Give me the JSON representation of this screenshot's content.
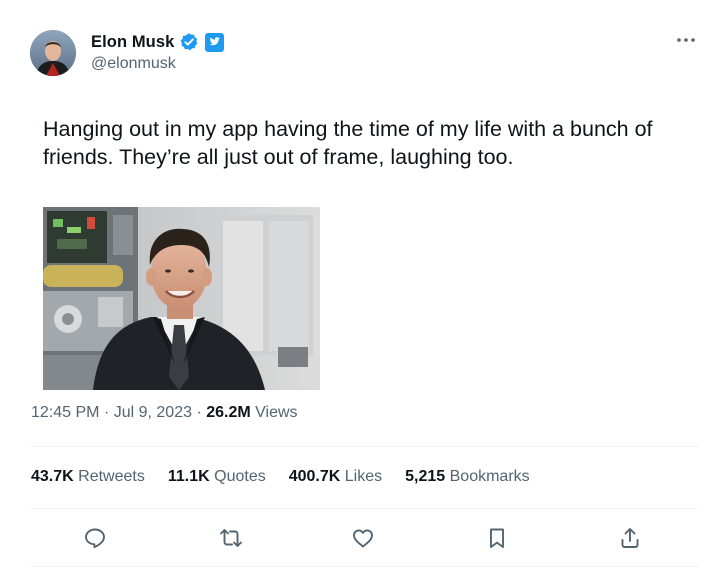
{
  "author": {
    "display_name": "Elon Musk",
    "handle": "@elonmusk",
    "verified_badge_color": "#1d9bf0",
    "avatar_icon": "profile-photo"
  },
  "more_icon": "more-horizontal-icon",
  "tweet": {
    "text": "Hanging out in my app having the time of my life with a bunch of friends. They’re all just out of frame, laughing too.",
    "media_description_icon": "photo"
  },
  "meta": {
    "time": "12:45 PM",
    "separator": "·",
    "date": "Jul 9, 2023",
    "views_count": "26.2M",
    "views_label": "Views"
  },
  "stats": [
    {
      "count": "43.7K",
      "label": "Retweets"
    },
    {
      "count": "11.1K",
      "label": "Quotes"
    },
    {
      "count": "400.7K",
      "label": "Likes"
    },
    {
      "count": "5,215",
      "label": "Bookmarks"
    }
  ],
  "actions": [
    {
      "name": "reply",
      "icon": "reply-icon"
    },
    {
      "name": "retweet",
      "icon": "retweet-icon"
    },
    {
      "name": "like",
      "icon": "heart-icon"
    },
    {
      "name": "bookmark",
      "icon": "bookmark-icon"
    },
    {
      "name": "share",
      "icon": "share-icon"
    }
  ],
  "colors": {
    "text_primary": "#0f1419",
    "text_secondary": "#536471",
    "divider": "#eff3f4",
    "twitter_blue": "#1d9bf0"
  }
}
